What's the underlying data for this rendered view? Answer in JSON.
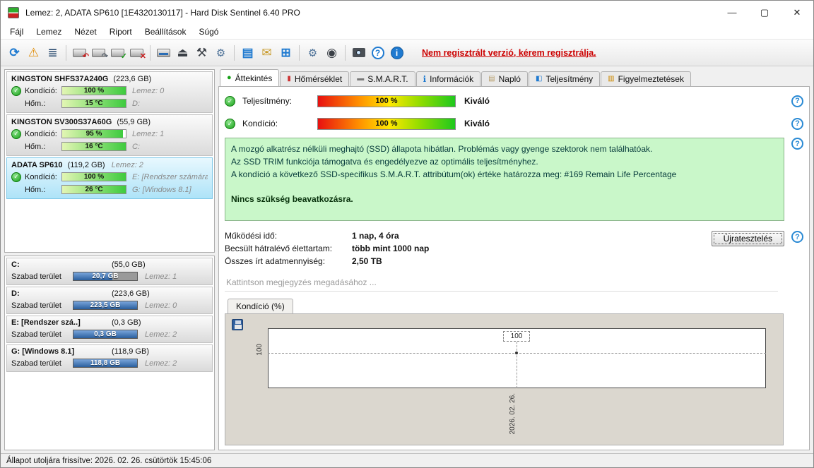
{
  "titlebar": {
    "title": "Lemez: 2, ADATA SP610 [1E4320130117]  -  Hard Disk Sentinel 6.40 PRO",
    "minimize": "—",
    "maximize": "▢",
    "close": "✕"
  },
  "menu": {
    "items": [
      {
        "label": "Fájl"
      },
      {
        "label": "Lemez"
      },
      {
        "label": "Nézet"
      },
      {
        "label": "Riport"
      },
      {
        "label": "Beállítások"
      },
      {
        "label": "Súgó"
      }
    ]
  },
  "icons": {
    "check": "✓",
    "help": "?",
    "info": "i"
  },
  "toolbar": {
    "unregistered": "Nem regisztrált verzió, kérem regisztrálja.",
    "icons": {
      "refresh": "⟳",
      "disk_test": "⚠",
      "report": "≣",
      "undo_arrow": "↶",
      "redo_arrow": "↷",
      "ok_arrow": "✓",
      "remove_arrow": "✕",
      "eject": "⏏",
      "tools": "⚒",
      "gear_small": "⚙",
      "notes": "▤",
      "mail": "✉",
      "devices": "⊞",
      "settings": "⚙",
      "dark_gear": "◉"
    }
  },
  "sidebar": {
    "disks": [
      {
        "name": "KINGSTON SHFS37A240G",
        "size": "(223,6 GB)",
        "disk_no": "",
        "cond_label": "Kondíció:",
        "cond_value": "100 %",
        "cond_right": "Lemez: 0",
        "temp_label": "Hőm.:",
        "temp_value": "15 °C",
        "temp_right": "D:"
      },
      {
        "name": "KINGSTON SV300S37A60G",
        "size": "(55,9 GB)",
        "disk_no": "",
        "cond_label": "Kondíció:",
        "cond_value": "95 %",
        "cond_right": "Lemez: 1",
        "temp_label": "Hőm.:",
        "temp_value": "16 °C",
        "temp_right": "C:"
      },
      {
        "name": "ADATA SP610",
        "size": "(119,2 GB)",
        "disk_no": "Lemez: 2",
        "cond_label": "Kondíció:",
        "cond_value": "100 %",
        "cond_right": "E: [Rendszer számára",
        "temp_label": "Hőm.:",
        "temp_value": "26 °C",
        "temp_right": "G: [Windows 8.1]"
      }
    ],
    "partitions": [
      {
        "name": "C:",
        "size": "(55,0 GB)",
        "free_label": "Szabad terület",
        "free_value": "20,7 GB",
        "right": "Lemez: 1"
      },
      {
        "name": "D:",
        "size": "(223,6 GB)",
        "free_label": "Szabad terület",
        "free_value": "223,5 GB",
        "right": "Lemez: 0"
      },
      {
        "name": "E: [Rendszer szá..]",
        "size": "(0,3 GB)",
        "free_label": "Szabad terület",
        "free_value": "0,3 GB",
        "right": "Lemez: 2"
      },
      {
        "name": "G: [Windows 8.1]",
        "size": "(118,9 GB)",
        "free_label": "Szabad terület",
        "free_value": "118,8 GB",
        "right": "Lemez: 2"
      }
    ]
  },
  "tabs": {
    "items": [
      {
        "label": "Áttekintés",
        "icon": "●"
      },
      {
        "label": "Hőmérséklet",
        "icon": "▮"
      },
      {
        "label": "S.M.A.R.T.",
        "icon": "▬"
      },
      {
        "label": "Információk",
        "icon": "ℹ"
      },
      {
        "label": "Napló",
        "icon": "▤"
      },
      {
        "label": "Teljesítmény",
        "icon": "◧"
      },
      {
        "label": "Figyelmeztetések",
        "icon": "▥"
      }
    ]
  },
  "overview": {
    "rows": [
      {
        "label": "Teljesítmény:",
        "value": "100 %",
        "rating": "Kiváló"
      },
      {
        "label": "Kondíció:",
        "value": "100 %",
        "rating": "Kiváló"
      }
    ],
    "info_lines": [
      "A mozgó alkatrész nélküli meghajtó (SSD) állapota hibátlan. Problémás vagy gyenge szektorok nem találhatóak.",
      "Az SSD TRIM funkciója támogatva és engedélyezve az optimális teljesítményhez.",
      "A kondíció a következő SSD-specifikus S.M.A.R.T. attribútum(ok) értéke határozza meg:  #169 Remain Life Percentage"
    ],
    "info_bold": "Nincs szükség beavatkozásra.",
    "stats": [
      {
        "label": "Működési idő:",
        "value": "1 nap, 4 óra"
      },
      {
        "label": "Becsült hátralévő élettartam:",
        "value": "több mint 1000 nap"
      },
      {
        "label": "Összes írt adatmennyiség:",
        "value": "2,50 TB"
      }
    ],
    "retest_button": "Újratesztelés",
    "comment_placeholder": "Kattintson megjegyzés megadásához ..."
  },
  "chart": {
    "tab_label": "Kondíció  (%)",
    "y_tick": "100",
    "point_label": "100",
    "x_tick": "2026. 02. 26."
  },
  "chart_data": {
    "type": "line",
    "title": "Kondíció (%)",
    "x": [
      "2026. 02. 26."
    ],
    "series": [
      {
        "name": "Kondíció",
        "values": [
          100
        ]
      }
    ],
    "ylabel": "Kondíció (%)",
    "ylim": [
      0,
      150
    ],
    "grid": "dashed",
    "legend": "none"
  },
  "statusbar": {
    "text": "Állapot utoljára frissítve: 2026. 02. 26. csütörtök 15:45:06"
  }
}
